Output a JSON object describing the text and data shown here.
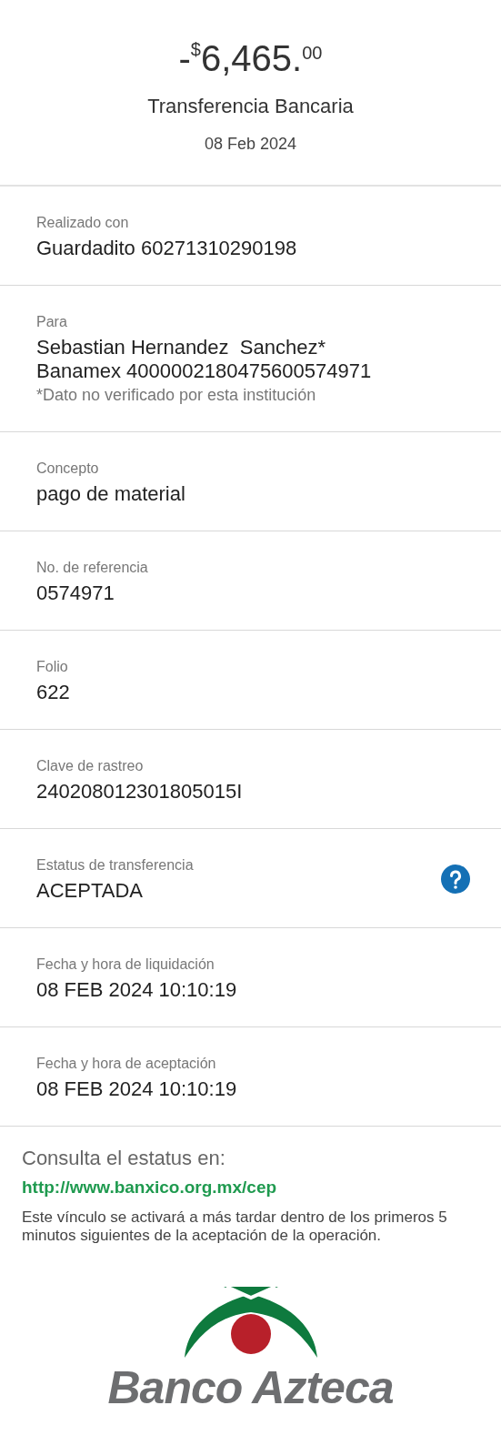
{
  "header": {
    "amount": {
      "sign": "-",
      "currency": "$",
      "whole": "6,465.",
      "cents": "00"
    },
    "title": "Transferencia Bancaria",
    "date": "08 Feb 2024"
  },
  "fields": [
    {
      "label": "Realizado con",
      "values": [
        "Guardadito 60271310290198"
      ],
      "help": false
    },
    {
      "label": "Para",
      "values": [
        "Sebastian Hernandez  Sanchez*",
        "Banamex 4000002180475600574971"
      ],
      "note": "*Dato no verificado por esta institución",
      "help": false
    },
    {
      "label": "Concepto",
      "values": [
        "pago de material"
      ],
      "help": false
    },
    {
      "label": "No. de referencia",
      "values": [
        "0574971"
      ],
      "help": false
    },
    {
      "label": "Folio",
      "values": [
        "622"
      ],
      "help": false
    },
    {
      "label": "Clave de rastreo",
      "values": [
        "240208012301805015I"
      ],
      "help": false
    },
    {
      "label": "Estatus de transferencia",
      "values": [
        "ACEPTADA"
      ],
      "help": true
    },
    {
      "label": "Fecha y hora de liquidación",
      "values": [
        "08 FEB 2024 10:10:19"
      ],
      "help": false
    },
    {
      "label": "Fecha y hora de aceptación",
      "values": [
        "08 FEB 2024 10:10:19"
      ],
      "help": false
    }
  ],
  "footer": {
    "heading": "Consulta el estatus en:",
    "link": "http://www.banxico.org.mx/cep",
    "note": "Este vínculo se activará a más tardar dentro de los primeros 5 minutos siguientes de la aceptación de la operación."
  },
  "logo": {
    "name": "Banco Azteca"
  }
}
